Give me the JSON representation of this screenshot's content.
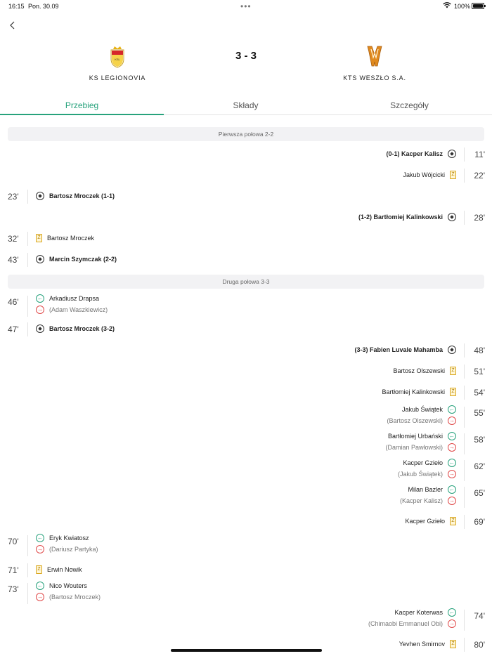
{
  "status": {
    "time": "16:15",
    "date": "Pon. 30.09",
    "battery": "100%",
    "battery_level": 1.0
  },
  "match": {
    "home": {
      "name": "KS LEGIONOVIA",
      "crest": "legionovia-crest-icon"
    },
    "away": {
      "name": "KTS WESZŁO S.A.",
      "crest": "weszlo-crest-icon"
    },
    "score": "3 - 3"
  },
  "tabs": [
    {
      "label": "Przebieg",
      "active": true
    },
    {
      "label": "Składy",
      "active": false
    },
    {
      "label": "Szczegóły",
      "active": false
    }
  ],
  "halves": [
    {
      "label": "Pierwsza połowa  2-2"
    },
    {
      "label": "Druga połowa  3-3"
    }
  ],
  "events": [
    {
      "side": "right",
      "minute": "11'",
      "type": "goal",
      "text": "(0-1)  Kacper Kalisz"
    },
    {
      "side": "right",
      "minute": "22'",
      "type": "card",
      "text": "Jakub Wójcicki"
    },
    {
      "side": "left",
      "minute": "23'",
      "type": "goal",
      "text": "Bartosz Mroczek  (1-1)"
    },
    {
      "side": "right",
      "minute": "28'",
      "type": "goal",
      "text": "(1-2)  Bartłomiej Kalinkowski"
    },
    {
      "side": "left",
      "minute": "32'",
      "type": "card",
      "text": "Bartosz Mroczek"
    },
    {
      "side": "left",
      "minute": "43'",
      "type": "goal",
      "text": "Marcin Szymczak  (2-2)"
    },
    {
      "side": "left",
      "minute": "46'",
      "type": "sub",
      "in": "Arkadiusz Drapsa",
      "out": "(Adam Waszkiewicz)"
    },
    {
      "side": "left",
      "minute": "47'",
      "type": "goal",
      "text": "Bartosz Mroczek  (3-2)"
    },
    {
      "side": "right",
      "minute": "48'",
      "type": "goal",
      "text": "(3-3)  Fabien Luvale Mahamba"
    },
    {
      "side": "right",
      "minute": "51'",
      "type": "card",
      "text": "Bartosz Olszewski"
    },
    {
      "side": "right",
      "minute": "54'",
      "type": "card",
      "text": "Bartłomiej Kalinkowski"
    },
    {
      "side": "right",
      "minute": "55'",
      "type": "sub",
      "in": "Jakub Świątek",
      "out": "(Bartosz Olszewski)"
    },
    {
      "side": "right",
      "minute": "58'",
      "type": "sub",
      "in": "Bartłomiej Urbański",
      "out": "(Damian Pawłowski)"
    },
    {
      "side": "right",
      "minute": "62'",
      "type": "sub",
      "in": "Kacper Gzieło",
      "out": "(Jakub Świątek)"
    },
    {
      "side": "right",
      "minute": "65'",
      "type": "sub",
      "in": "Milan Bazler",
      "out": "(Kacper Kalisz)"
    },
    {
      "side": "right",
      "minute": "69'",
      "type": "card",
      "text": "Kacper Gzieło"
    },
    {
      "side": "left",
      "minute": "70'",
      "type": "sub",
      "in": "Eryk Kwiatosz",
      "out": "(Dariusz Partyka)"
    },
    {
      "side": "left",
      "minute": "71'",
      "type": "card",
      "text": "Erwin Nowik"
    },
    {
      "side": "left",
      "minute": "73'",
      "type": "sub",
      "in": "Nico Wouters",
      "out": "(Bartosz Mroczek)"
    },
    {
      "side": "right",
      "minute": "74'",
      "type": "sub",
      "in": "Kacper Koterwas",
      "out": "(Chimaobi Emmanuel Obi)"
    },
    {
      "side": "right",
      "minute": "80'",
      "type": "card",
      "text": "Yevhen Smirnov"
    }
  ],
  "colors": {
    "accent": "#27a27c",
    "card": "#d9a51a",
    "sub_in": "#27a27c",
    "sub_out": "#e04848"
  }
}
